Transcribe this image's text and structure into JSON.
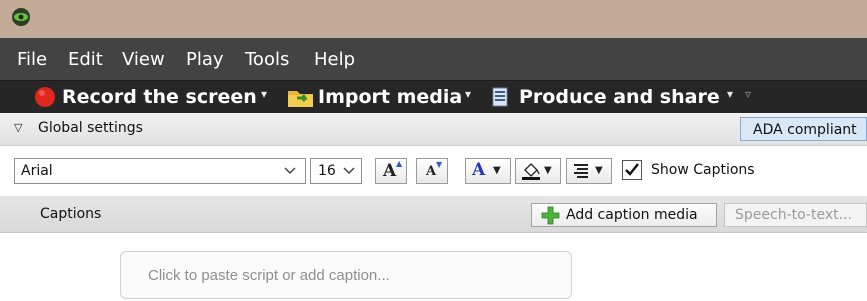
{
  "menu": [
    "File",
    "Edit",
    "View",
    "Play",
    "Tools",
    "Help"
  ],
  "toolbar": {
    "record_label": "Record the screen",
    "import_label": "Import media",
    "produce_label": "Produce and share",
    "caret": "▾",
    "more": "▿"
  },
  "global_settings": {
    "label": "Global settings",
    "ada_label": "ADA compliant"
  },
  "format": {
    "font": "Arial",
    "size": "16",
    "increase_size_glyph": "A",
    "decrease_size_glyph": "A",
    "font_color_glyph": "A",
    "show_captions_label": "Show Captions",
    "show_captions_checked": true
  },
  "captions": {
    "title": "Captions",
    "add_media_label": "Add caption media",
    "speech_label": "Speech-to-text...",
    "input_placeholder": "Click to paste script or add caption..."
  },
  "colors": {
    "titlebar": "#c4ab97",
    "menubar": "#434343",
    "toolbar": "#262626",
    "record_red": "#e0261d",
    "font_color_blue": "#2035b8"
  }
}
